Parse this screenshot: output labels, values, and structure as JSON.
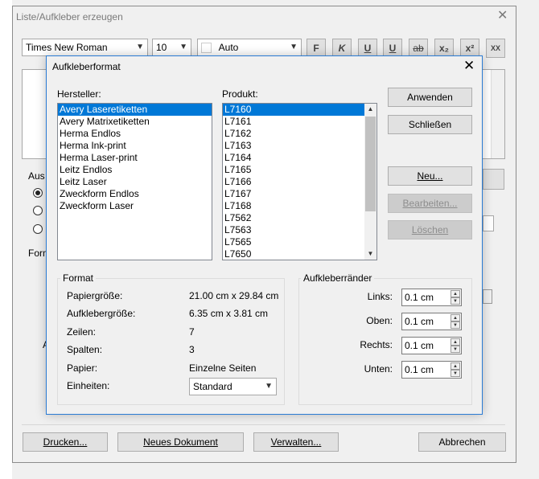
{
  "main_window": {
    "title": "Liste/Aufkleber erzeugen",
    "font_name": "Times New Roman",
    "font_size": "10",
    "color": "Auto",
    "format_buttons": [
      "F",
      "K",
      "U",
      "U",
      "ab",
      "x₂",
      "x²",
      "XX"
    ],
    "label_aus": "Aus",
    "label_form": "Form",
    "label_a": "A",
    "buttons": {
      "drucken": "Drucken...",
      "neues_dokument": "Neues Dokument",
      "verwalten": "Verwalten...",
      "abbrechen": "Abbrechen"
    }
  },
  "dialog": {
    "title": "Aufkleberformat",
    "hersteller_label": "Hersteller:",
    "produkt_label": "Produkt:",
    "hersteller": [
      "Avery Laseretiketten",
      "Avery Matrixetiketten",
      "Herma Endlos",
      "Herma Ink-print",
      "Herma Laser-print",
      "Leitz Endlos",
      "Leitz Laser",
      "Zweckform Endlos",
      "Zweckform Laser"
    ],
    "produkt": [
      "L7160",
      "L7161",
      "L7162",
      "L7163",
      "L7164",
      "L7165",
      "L7166",
      "L7167",
      "L7168",
      "L7562",
      "L7563",
      "L7565",
      "L7650"
    ],
    "buttons": {
      "anwenden": "Anwenden",
      "schliessen": "Schließen",
      "neu": "Neu...",
      "bearbeiten": "Bearbeiten...",
      "loeschen": "Löschen"
    },
    "format": {
      "title": "Format",
      "rows": [
        {
          "label": "Papiergröße:",
          "value": "21.00 cm x 29.84 cm"
        },
        {
          "label": "Aufklebergröße:",
          "value": "6.35 cm x 3.81 cm"
        },
        {
          "label": "Zeilen:",
          "value": "7"
        },
        {
          "label": "Spalten:",
          "value": "3"
        },
        {
          "label": "Papier:",
          "value": "Einzelne Seiten"
        }
      ],
      "einheiten_label": "Einheiten:",
      "einheiten_value": "Standard"
    },
    "raender": {
      "title": "Aufkleberränder",
      "rows": [
        {
          "label": "Links:",
          "value": "0.1 cm"
        },
        {
          "label": "Oben:",
          "value": "0.1 cm"
        },
        {
          "label": "Rechts:",
          "value": "0.1 cm"
        },
        {
          "label": "Unten:",
          "value": "0.1 cm"
        }
      ]
    }
  }
}
